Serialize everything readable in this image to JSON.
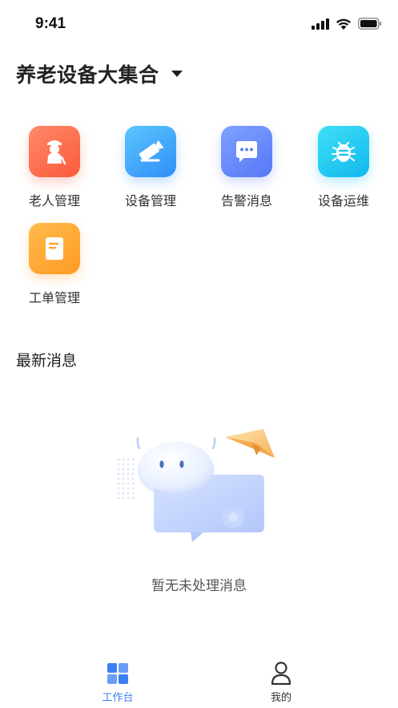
{
  "status_bar": {
    "time": "9:41"
  },
  "header": {
    "title": "养老设备大集合"
  },
  "grid": {
    "items": [
      {
        "label": "老人管理",
        "icon": "elderly-person-icon"
      },
      {
        "label": "设备管理",
        "icon": "camera-device-icon"
      },
      {
        "label": "告警消息",
        "icon": "message-bubble-icon"
      },
      {
        "label": "设备运维",
        "icon": "bug-maintenance-icon"
      },
      {
        "label": "工单管理",
        "icon": "work-order-icon"
      }
    ]
  },
  "news": {
    "title": "最新消息",
    "empty_text": "暂无未处理消息"
  },
  "tab_bar": {
    "tabs": [
      {
        "label": "工作台",
        "icon": "workbench-grid-icon",
        "active": true
      },
      {
        "label": "我的",
        "icon": "user-profile-icon",
        "active": false
      }
    ]
  },
  "colors": {
    "accent": "#3d7ff5",
    "orange": "#fa5a3a",
    "skyblue": "#2f8ff7",
    "indigo": "#5577f6",
    "cyan": "#11b8ee",
    "amber": "#ff9a26"
  }
}
